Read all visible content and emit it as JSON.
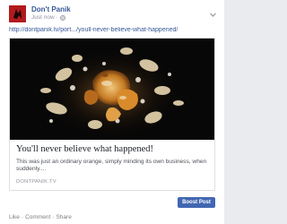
{
  "post": {
    "page_name": "Don't Panik",
    "timestamp": "Just now",
    "privacy_icon": "globe-icon",
    "link_text": "http://dontpanik.tv/port.../youll-never-believe-what-happened/"
  },
  "link_preview": {
    "title": "You'll never believe what happened!",
    "description": "This was just an ordinary orange, simply minding its own business, when suddenly....",
    "domain": "DONTPANIK.TV"
  },
  "actions": {
    "boost_label": "Boost Post",
    "like_label": "Like",
    "comment_label": "Comment",
    "share_label": "Share",
    "separator": "·"
  },
  "colors": {
    "brand_link": "#365899",
    "boost_button": "#4267b2",
    "avatar_bg": "#b21a1e"
  }
}
